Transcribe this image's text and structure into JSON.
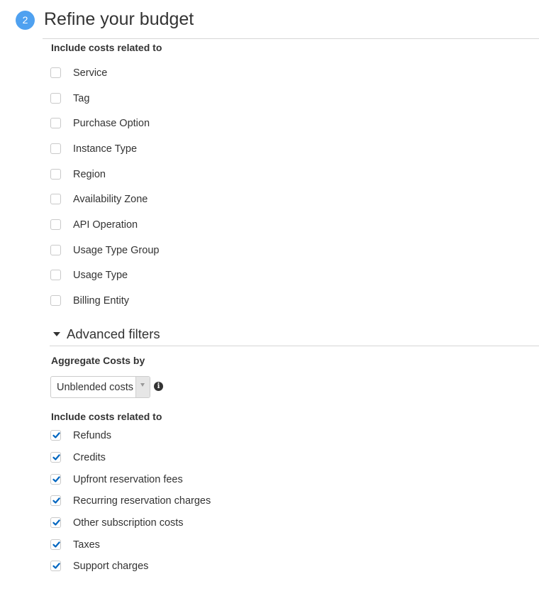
{
  "step": {
    "number": "2",
    "title": "Refine your budget"
  },
  "include_section": {
    "label": "Include costs related to",
    "options": [
      {
        "label": "Service",
        "checked": false
      },
      {
        "label": "Tag",
        "checked": false
      },
      {
        "label": "Purchase Option",
        "checked": false
      },
      {
        "label": "Instance Type",
        "checked": false
      },
      {
        "label": "Region",
        "checked": false
      },
      {
        "label": "Availability Zone",
        "checked": false
      },
      {
        "label": "API Operation",
        "checked": false
      },
      {
        "label": "Usage Type Group",
        "checked": false
      },
      {
        "label": "Usage Type",
        "checked": false
      },
      {
        "label": "Billing Entity",
        "checked": false
      }
    ]
  },
  "advanced_filters": {
    "title": "Advanced filters",
    "expanded": true,
    "aggregate": {
      "label": "Aggregate Costs by",
      "selected": "Unblended costs",
      "info_icon": "info-icon"
    },
    "include_label": "Include costs related to",
    "options": [
      {
        "label": "Refunds",
        "checked": true
      },
      {
        "label": "Credits",
        "checked": true
      },
      {
        "label": "Upfront reservation fees",
        "checked": true
      },
      {
        "label": "Recurring reservation charges",
        "checked": true
      },
      {
        "label": "Other subscription costs",
        "checked": true
      },
      {
        "label": "Taxes",
        "checked": true
      },
      {
        "label": "Support charges",
        "checked": true
      }
    ]
  },
  "colors": {
    "step_badge": "#4fa1f0",
    "check_mark": "#0066c0",
    "text": "#333333",
    "divider": "#d6d6d6"
  }
}
